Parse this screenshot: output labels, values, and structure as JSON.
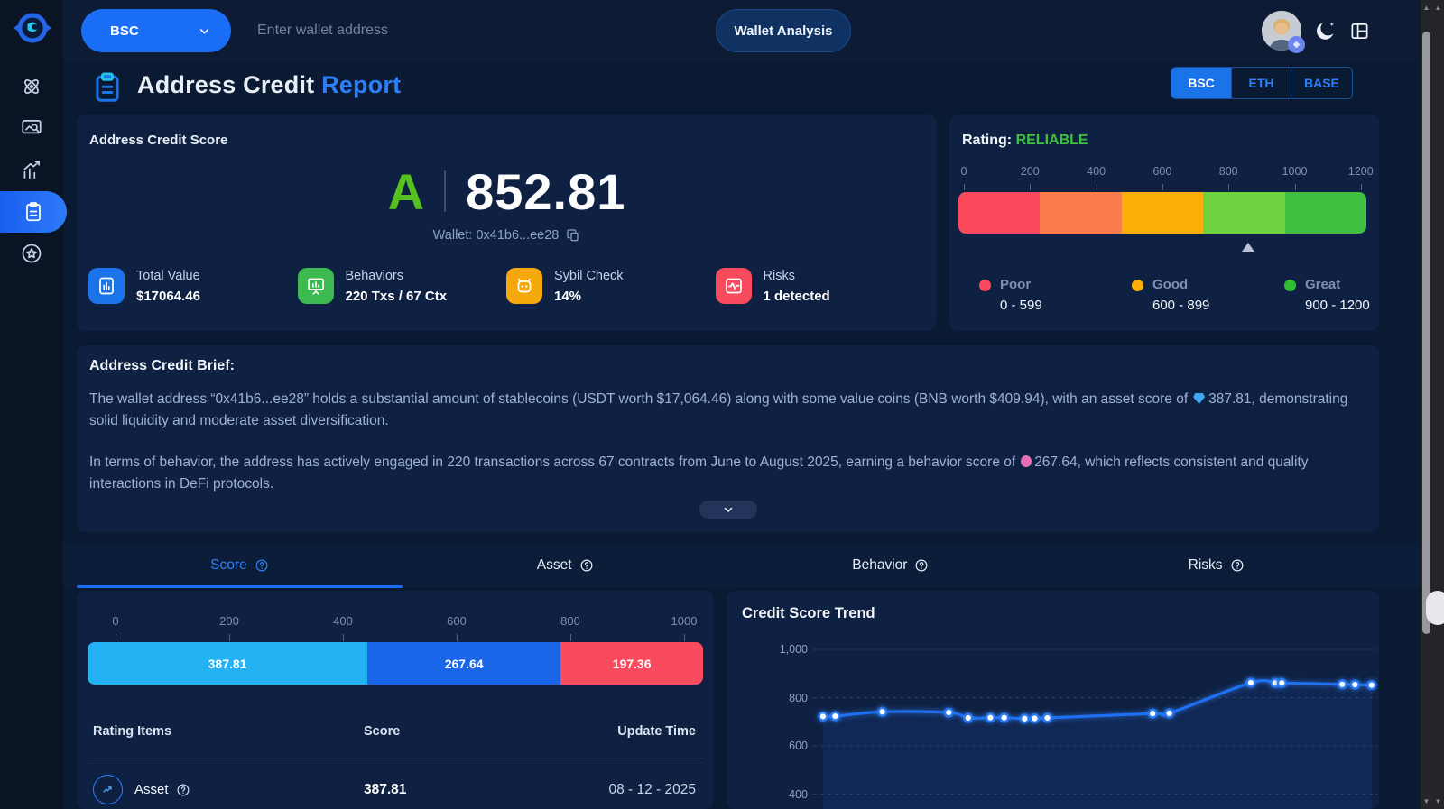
{
  "topbar": {
    "network": "BSC",
    "search_placeholder": "Enter wallet address",
    "analyze_label": "Wallet Analysis"
  },
  "sidebar": {
    "items": [
      {
        "icon": "atom-icon",
        "active": false
      },
      {
        "icon": "screen-search-icon",
        "active": false
      },
      {
        "icon": "chart-growth-icon",
        "active": false
      },
      {
        "icon": "report-icon",
        "active": true
      },
      {
        "icon": "star-badge-icon",
        "active": false
      }
    ]
  },
  "header": {
    "title_main": "Address Credit",
    "title_accent": "Report",
    "network_tabs": [
      {
        "label": "BSC",
        "active": true
      },
      {
        "label": "ETH",
        "active": false
      },
      {
        "label": "BASE",
        "active": false
      }
    ]
  },
  "score_panel": {
    "title": "Address Credit Score",
    "grade": "A",
    "score": "852.81",
    "wallet": "Wallet: 0x41b6...ee28",
    "stats": [
      {
        "label": "Total Value",
        "value": "$17064.46",
        "color": "#1b74e9",
        "icon": "chart-board-icon"
      },
      {
        "label": "Behaviors",
        "value": "220 Txs / 67 Ctx",
        "color": "#3cba50",
        "icon": "presentation-icon"
      },
      {
        "label": "Sybil Check",
        "value": "14%",
        "color": "#f5a80b",
        "icon": "robot-icon"
      },
      {
        "label": "Risks",
        "value": "1 detected",
        "color": "#f94b5e",
        "icon": "pulse-icon"
      }
    ]
  },
  "rating_panel": {
    "label": "Rating:",
    "value": "RELIABLE",
    "value_color": "#3fc043",
    "ticks": [
      "0",
      "200",
      "400",
      "600",
      "800",
      "1000",
      "1200"
    ],
    "scale_max": 1200,
    "marker_value": 852.81,
    "segment_colors": [
      "#fc4a5c",
      "#fa7c4b",
      "#fbae08",
      "#6ed33f",
      "#3fbe3f"
    ],
    "legend": [
      {
        "name": "Poor",
        "range": "0 - 599",
        "color": "#fc4a5c"
      },
      {
        "name": "Good",
        "range": "600 - 899",
        "color": "#fbae08"
      },
      {
        "name": "Great",
        "range": "900 - 1200",
        "color": "#2fbe2f"
      }
    ]
  },
  "brief": {
    "title": "Address Credit Brief:",
    "p1_before": "The wallet address “0x41b6...ee28” holds a substantial amount of stablecoins (USDT worth $17,064.46) along with some value coins (BNB worth $409.94), with an asset score of",
    "p1_icon": "gem-icon",
    "p1_after": "387.81, demonstrating solid liquidity and moderate asset diversification.",
    "p2_before": "In terms of behavior, the address has actively engaged in 220 transactions across 67 contracts from June to August 2025, earning a behavior score of",
    "p2_icon": "balloon-icon",
    "p2_after": "267.64, which reflects consistent and quality interactions in DeFi protocols."
  },
  "tabs": [
    {
      "label": "Score",
      "active": true
    },
    {
      "label": "Asset",
      "active": false
    },
    {
      "label": "Behavior",
      "active": false
    },
    {
      "label": "Risks",
      "active": false
    }
  ],
  "score_tab": {
    "ruler_ticks": [
      "0",
      "200",
      "400",
      "600",
      "800",
      "1000"
    ],
    "bar_segments": [
      {
        "label": "387.81",
        "value": 387.81,
        "color": "#24b2f2"
      },
      {
        "label": "267.64",
        "value": 267.64,
        "color": "#1a66e8"
      },
      {
        "label": "197.36",
        "value": 197.36,
        "color": "#f94b5e"
      }
    ],
    "table": {
      "headers": [
        "Rating Items",
        "Score",
        "Update Time"
      ],
      "rows": [
        {
          "item": "Asset",
          "icon": "trend-circle-icon",
          "score": "387.81",
          "update_time": "08 - 12 - 2025"
        }
      ]
    }
  },
  "trend_panel": {
    "title": "Credit Score Trend",
    "chart_data": {
      "type": "line",
      "title": "Credit Score Trend",
      "y_tick_labels": [
        "1,000",
        "800",
        "600",
        "400"
      ],
      "y_ticks": [
        1000,
        800,
        600,
        400
      ],
      "ylim_visible": [
        400,
        1000
      ],
      "grid": "dashed horizontal",
      "line_color": "#1f6ff2",
      "point_style": "white-glow-dots",
      "x_fractions": [
        0.008,
        0.03,
        0.115,
        0.235,
        0.27,
        0.31,
        0.335,
        0.372,
        0.39,
        0.413,
        0.603,
        0.633,
        0.78,
        0.824,
        0.836,
        0.945,
        0.968,
        0.998
      ],
      "values": [
        722,
        723,
        741,
        738,
        716,
        717,
        717,
        713,
        714,
        716,
        734,
        735,
        862,
        861,
        861,
        855,
        854,
        852
      ]
    }
  }
}
